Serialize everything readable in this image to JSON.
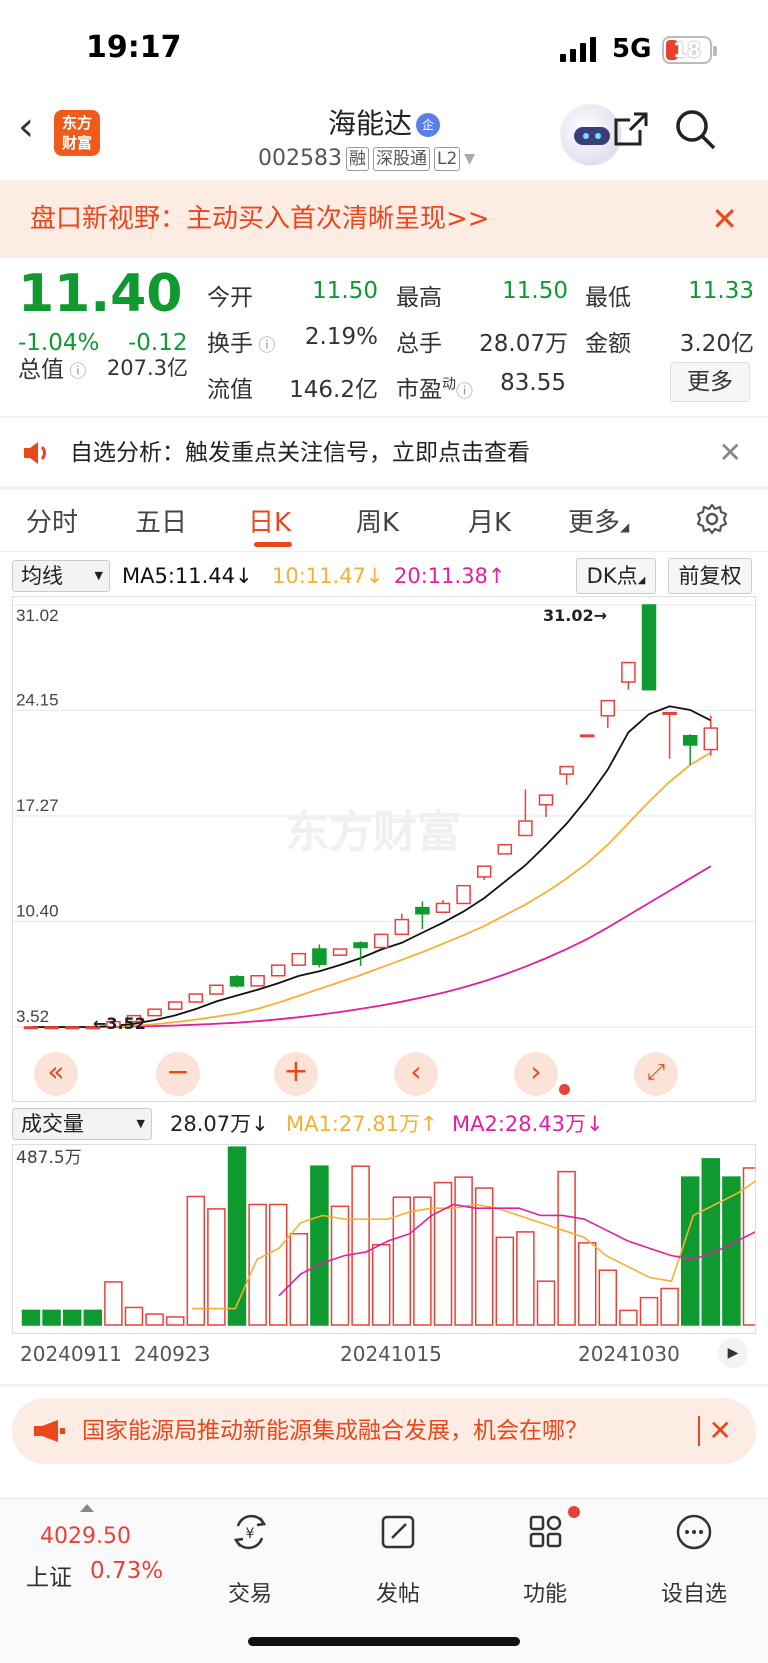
{
  "status": {
    "time": "19:17",
    "network": "5G",
    "battery": "18"
  },
  "header": {
    "logo_line1": "东方",
    "logo_line2": "财富",
    "stock_name": "海能达",
    "qi_badge": "企",
    "code": "002583",
    "tags": [
      "融",
      "深股通",
      "L2"
    ]
  },
  "banner": {
    "text": "盘口新视野：主动买入首次清晰呈现>>"
  },
  "quote": {
    "price": "11.40",
    "change_pct": "-1.04%",
    "change": "-0.12",
    "open_label": "今开",
    "open": "11.50",
    "high_label": "最高",
    "high": "11.50",
    "low_label": "最低",
    "low": "11.33",
    "turnover_label": "换手",
    "turnover": "2.19%",
    "volume_label": "总手",
    "volume": "28.07万",
    "amount_label": "金额",
    "amount": "3.20亿",
    "mktcap_label": "总值",
    "mktcap": "207.3亿",
    "float_label": "流值",
    "float": "146.2亿",
    "pe_label": "市盈",
    "pe_sup": "动",
    "pe": "83.55",
    "more_label": "更多"
  },
  "alert": {
    "text": "自选分析：触发重点关注信号，立即点击查看"
  },
  "tabs": [
    "分时",
    "五日",
    "日K",
    "周K",
    "月K",
    "更多"
  ],
  "ma_bar": {
    "select": "均线",
    "ma5": "MA5:11.44↓",
    "ma10": "10:11.47↓",
    "ma20": "20:11.38↑",
    "dk": "DK点",
    "fq": "前复权"
  },
  "colors": {
    "up": "#e8413a",
    "down": "#0f9a30",
    "accent": "#e8481c",
    "ma5": "#111111",
    "ma10": "#f5b030",
    "ma20": "#e020a0"
  },
  "chart_data": {
    "type": "candlestick",
    "y_ticks": [
      "31.02",
      "24.15",
      "17.27",
      "10.40",
      "3.52"
    ],
    "ylim": [
      3.52,
      31.02
    ],
    "max_label": "31.02→",
    "min_label": "←3.52",
    "watermark": "东方财富",
    "candles": [
      {
        "o": 3.52,
        "c": 3.52,
        "h": 3.55,
        "l": 3.5
      },
      {
        "o": 3.52,
        "c": 3.52,
        "h": 3.55,
        "l": 3.5
      },
      {
        "o": 3.52,
        "c": 3.52,
        "h": 3.55,
        "l": 3.5
      },
      {
        "o": 3.52,
        "c": 3.52,
        "h": 3.55,
        "l": 3.5
      },
      {
        "o": 3.52,
        "c": 3.87,
        "h": 3.87,
        "l": 3.52
      },
      {
        "o": 3.87,
        "c": 4.26,
        "h": 4.26,
        "l": 3.87
      },
      {
        "o": 4.26,
        "c": 4.68,
        "h": 4.68,
        "l": 4.26
      },
      {
        "o": 4.68,
        "c": 5.15,
        "h": 5.15,
        "l": 4.68
      },
      {
        "o": 5.15,
        "c": 5.67,
        "h": 5.67,
        "l": 5.15
      },
      {
        "o": 5.67,
        "c": 6.24,
        "h": 6.24,
        "l": 5.67
      },
      {
        "o": 6.8,
        "c": 6.2,
        "h": 6.9,
        "l": 6.1
      },
      {
        "o": 6.2,
        "c": 6.86,
        "h": 6.86,
        "l": 6.2
      },
      {
        "o": 6.86,
        "c": 7.55,
        "h": 7.55,
        "l": 6.86
      },
      {
        "o": 7.55,
        "c": 8.3,
        "h": 8.3,
        "l": 7.55
      },
      {
        "o": 8.6,
        "c": 7.6,
        "h": 8.9,
        "l": 7.4
      },
      {
        "o": 8.2,
        "c": 8.6,
        "h": 8.6,
        "l": 8.2
      },
      {
        "o": 9.0,
        "c": 8.7,
        "h": 9.1,
        "l": 7.5
      },
      {
        "o": 8.7,
        "c": 9.56,
        "h": 9.56,
        "l": 8.7
      },
      {
        "o": 9.56,
        "c": 10.52,
        "h": 10.9,
        "l": 9.56
      },
      {
        "o": 11.3,
        "c": 10.9,
        "h": 11.7,
        "l": 9.9
      },
      {
        "o": 11.0,
        "c": 11.57,
        "h": 11.8,
        "l": 11.0
      },
      {
        "o": 11.57,
        "c": 12.73,
        "h": 12.73,
        "l": 11.57
      },
      {
        "o": 13.3,
        "c": 14.0,
        "h": 14.0,
        "l": 13.1
      },
      {
        "o": 14.8,
        "c": 15.4,
        "h": 15.4,
        "l": 14.8
      },
      {
        "o": 16.0,
        "c": 16.94,
        "h": 19.0,
        "l": 16.0
      },
      {
        "o": 18.0,
        "c": 18.63,
        "h": 18.63,
        "l": 17.2
      },
      {
        "o": 20.0,
        "c": 20.49,
        "h": 20.49,
        "l": 19.3
      },
      {
        "o": 22.5,
        "c": 22.54,
        "h": 22.54,
        "l": 22.5
      },
      {
        "o": 23.8,
        "c": 24.79,
        "h": 24.79,
        "l": 23.0
      },
      {
        "o": 26.0,
        "c": 27.27,
        "h": 27.27,
        "l": 25.5
      },
      {
        "o": 31.02,
        "c": 25.5,
        "h": 31.02,
        "l": 25.5
      },
      {
        "o": 24.0,
        "c": 24.0,
        "h": 24.0,
        "l": 21.0
      },
      {
        "o": 22.5,
        "c": 21.9,
        "h": 22.6,
        "l": 20.6
      },
      {
        "o": 21.6,
        "c": 23.0,
        "h": 23.8,
        "l": 21.2
      }
    ],
    "ma5": [
      3.52,
      3.52,
      3.52,
      3.52,
      3.59,
      3.73,
      3.97,
      4.28,
      4.69,
      5.19,
      5.57,
      5.95,
      6.37,
      6.85,
      7.15,
      7.56,
      8.01,
      8.57,
      9.01,
      9.67,
      10.32,
      11.05,
      11.92,
      12.99,
      14.06,
      15.37,
      16.77,
      18.41,
      20.3,
      22.72,
      23.91,
      24.42,
      24.18,
      23.5
    ],
    "ma10": [
      3.52,
      3.52,
      3.52,
      3.52,
      3.55,
      3.6,
      3.7,
      3.84,
      4.0,
      4.2,
      4.4,
      4.7,
      5.1,
      5.55,
      6.0,
      6.45,
      6.9,
      7.4,
      7.9,
      8.4,
      8.95,
      9.5,
      10.1,
      10.8,
      11.5,
      12.3,
      13.2,
      14.2,
      15.4,
      16.8,
      18.2,
      19.5,
      20.6,
      21.4
    ],
    "ma20": [
      3.52,
      3.52,
      3.52,
      3.52,
      3.53,
      3.55,
      3.58,
      3.62,
      3.67,
      3.73,
      3.8,
      3.9,
      4.02,
      4.16,
      4.32,
      4.5,
      4.7,
      4.92,
      5.17,
      5.45,
      5.75,
      6.1,
      6.5,
      6.95,
      7.45,
      8.0,
      8.6,
      9.25,
      10.0,
      10.8,
      11.6,
      12.4,
      13.2,
      14.0
    ]
  },
  "vol_bar": {
    "select": "成交量",
    "vol": "28.07万↓",
    "ma1": "MA1:27.81万↑",
    "ma2": "MA2:28.43万↓"
  },
  "volume_data": {
    "max_label": "487.5万",
    "values": [
      40,
      40,
      40,
      40,
      118,
      48,
      30,
      22,
      352,
      318,
      487,
      330,
      330,
      250,
      435,
      325,
      435,
      220,
      350,
      350,
      390,
      405,
      375,
      240,
      255,
      120,
      420,
      225,
      150,
      40,
      75,
      100,
      405,
      455,
      405,
      430
    ],
    "dir": [
      "d",
      "d",
      "d",
      "d",
      "u",
      "u",
      "u",
      "u",
      "u",
      "u",
      "d",
      "u",
      "u",
      "u",
      "d",
      "u",
      "u",
      "u",
      "u",
      "u",
      "u",
      "u",
      "u",
      "u",
      "u",
      "u",
      "u",
      "u",
      "u",
      "u",
      "u",
      "u",
      "d",
      "d",
      "d",
      "u"
    ],
    "ma1": [
      0,
      0,
      0,
      0,
      0,
      0,
      0,
      45,
      45,
      45,
      180,
      210,
      280,
      300,
      290,
      290,
      290,
      310,
      320,
      320,
      330,
      320,
      300,
      280,
      260,
      240,
      190,
      160,
      130,
      120,
      300,
      330,
      360,
      400
    ],
    "ma2": [
      0,
      0,
      0,
      0,
      0,
      0,
      0,
      0,
      0,
      0,
      0,
      80,
      140,
      170,
      190,
      200,
      230,
      250,
      300,
      330,
      320,
      320,
      320,
      300,
      300,
      290,
      260,
      230,
      210,
      190,
      180,
      200,
      230,
      260
    ]
  },
  "dates": [
    "20240911",
    "240923",
    "20241015",
    "20241030"
  ],
  "ad": {
    "text": "国家能源局推动新能源集成融合发展，机会在哪？"
  },
  "bottom": {
    "index_value": "4029.50",
    "index_name": "上证",
    "index_pct": "0.73%",
    "items": [
      "交易",
      "发帖",
      "功能",
      "设自选"
    ]
  }
}
